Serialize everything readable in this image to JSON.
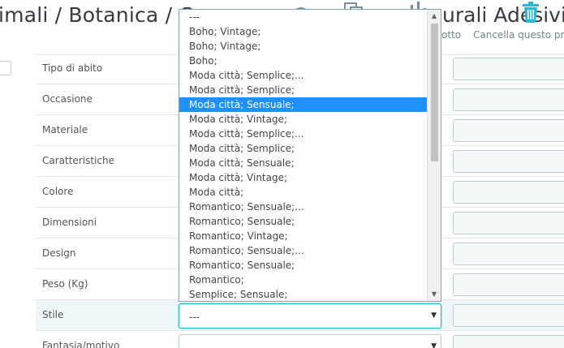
{
  "header": {
    "title_left": "imali / Botanica / C",
    "title_right": "urali Adesivi a",
    "link_partial": "otto",
    "link_delete": "Cancella questo pro"
  },
  "features": {
    "rows": [
      {
        "label": "Tipo di abito"
      },
      {
        "label": "Occasione"
      },
      {
        "label": "Materiale"
      },
      {
        "label": "Caratteristiche"
      },
      {
        "label": "Colore"
      },
      {
        "label": "Dimensioni"
      },
      {
        "label": "Design"
      },
      {
        "label": "Peso (Kg)"
      },
      {
        "label": "Stile",
        "select_value": "---"
      },
      {
        "label": "Fantasia/motivo",
        "select_value": "---"
      }
    ]
  },
  "dropdown": {
    "selected_index": 6,
    "options": [
      "---",
      "Boho; Vintage;",
      "Boho; Vintage;",
      "Boho;",
      "Moda città; Semplice;...",
      "Moda città; Semplice;",
      "Moda città; Sensuale;",
      "Moda città; Vintage;",
      "Moda città; Semplice;...",
      "Moda città; Semplice;",
      "Moda città; Sensuale;",
      "Moda città; Vintage;",
      "Moda città;",
      "Romantico; Sensuale;...",
      "Romantico; Sensuale;",
      "Romantico; Vintage;",
      "Romantico; Sensuale;...",
      "Romantico; Sensuale;",
      "Romantico;",
      "Semplice; Sensuale;"
    ]
  },
  "icons": {
    "header_icons": [
      "circle-icon",
      "copy-icon",
      "chart-icon",
      "trash-icon"
    ],
    "accent": "#25b9d7",
    "highlight": "#1e90ff"
  }
}
